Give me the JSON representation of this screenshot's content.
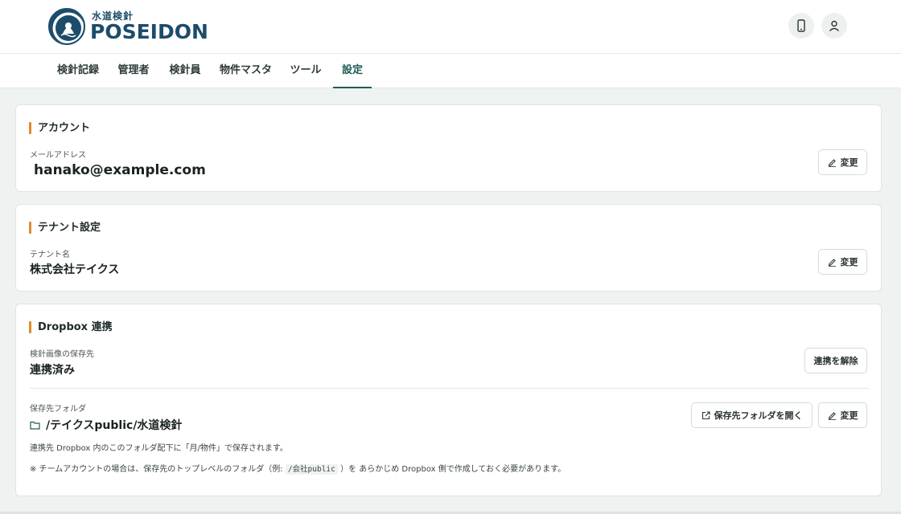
{
  "header": {
    "logo_sub": "水道検針",
    "logo_main": "POSEIDON",
    "phone_icon": "smartphone-icon",
    "user_icon": "user-icon"
  },
  "tabs": [
    {
      "label": "検針記録"
    },
    {
      "label": "管理者"
    },
    {
      "label": "検針員"
    },
    {
      "label": "物件マスタ"
    },
    {
      "label": "ツール"
    },
    {
      "label": "設定",
      "active": true
    }
  ],
  "account": {
    "title": "アカウント",
    "email_label": "メールアドレス",
    "email_value": "hanako@example.com",
    "change_button": "変更"
  },
  "tenant": {
    "title": "テナント設定",
    "name_label": "テナント名",
    "name_value": "株式会社テイクス",
    "change_button": "変更"
  },
  "dropbox": {
    "title": "Dropbox 連携",
    "dest_label": "検針画像の保存先",
    "dest_value": "連携済み",
    "unlink_button": "連携を解除",
    "folder_label": "保存先フォルダ",
    "folder_value": "/テイクスpublic/水道検針",
    "open_folder_button": "保存先フォルダを開く",
    "change_button": "変更",
    "note1": "連携先 Dropbox 内のこのフォルダ配下に「月/物件」で保存されます。",
    "note2_prefix": "※ チームアカウントの場合は、保存先のトップレベルのフォルダ（例:",
    "note2_code": "/会社public",
    "note2_suffix": "）を あらかじめ Dropbox 側で作成しておく必要があります。"
  },
  "colors": {
    "accent": "#1e5f56",
    "title_bar": "#e08a2c",
    "brand": "#1d4c6b"
  }
}
